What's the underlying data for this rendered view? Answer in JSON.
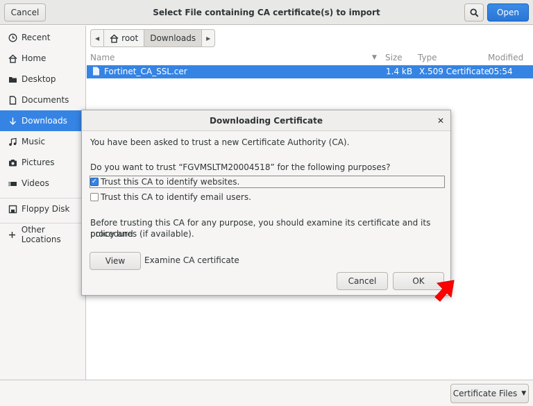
{
  "headerbar": {
    "cancel_label": "Cancel",
    "title": "Select File containing CA certificate(s) to import",
    "search_icon": "magnifier-icon",
    "open_label": "Open",
    "accent_color": "#3584e4"
  },
  "sidebar": {
    "items": [
      {
        "label": "Recent",
        "icon": "clock-icon"
      },
      {
        "label": "Home",
        "icon": "home-icon"
      },
      {
        "label": "Desktop",
        "icon": "folder-icon"
      },
      {
        "label": "Documents",
        "icon": "document-icon"
      },
      {
        "label": "Downloads",
        "icon": "down-arrow-icon",
        "active": true
      },
      {
        "label": "Music",
        "icon": "music-note-icon"
      },
      {
        "label": "Pictures",
        "icon": "camera-icon"
      },
      {
        "label": "Videos",
        "icon": "video-icon"
      },
      {
        "label": "Floppy Disk",
        "icon": "floppy-icon"
      },
      {
        "label": "Other Locations",
        "icon": "plus-icon"
      }
    ]
  },
  "pathbar": {
    "back_icon": "left-arrow-icon",
    "root_label": "root",
    "current_label": "Downloads",
    "forward_icon": "right-arrow-icon"
  },
  "files": {
    "columns": [
      "Name",
      "Size",
      "Type",
      "Modified"
    ],
    "rows": [
      {
        "name": "Fortinet_CA_SSL.cer",
        "size": "1.4 kB",
        "type": "X.509 Certificate",
        "modified": "05:54"
      }
    ]
  },
  "bottombar": {
    "filter_label": "Certificate Files"
  },
  "dialog": {
    "title": "Downloading Certificate",
    "line1": "You have been asked to trust a new Certificate Authority (CA).",
    "line2": "Do you want to trust “FGVMSLTM20004518” for the following purposes?",
    "check1": {
      "label": "Trust this CA to identify websites.",
      "checked": true
    },
    "check2": {
      "label": "Trust this CA to identify email users.",
      "checked": false
    },
    "line3a": "Before trusting this CA for any purpose, you should examine its certificate and its policy and",
    "line3b": "procedures (if available).",
    "view_label": "View",
    "view_caption": "Examine CA certificate",
    "cancel_label": "Cancel",
    "ok_label": "OK"
  },
  "annotation": {
    "arrow_color": "#ff0000"
  }
}
